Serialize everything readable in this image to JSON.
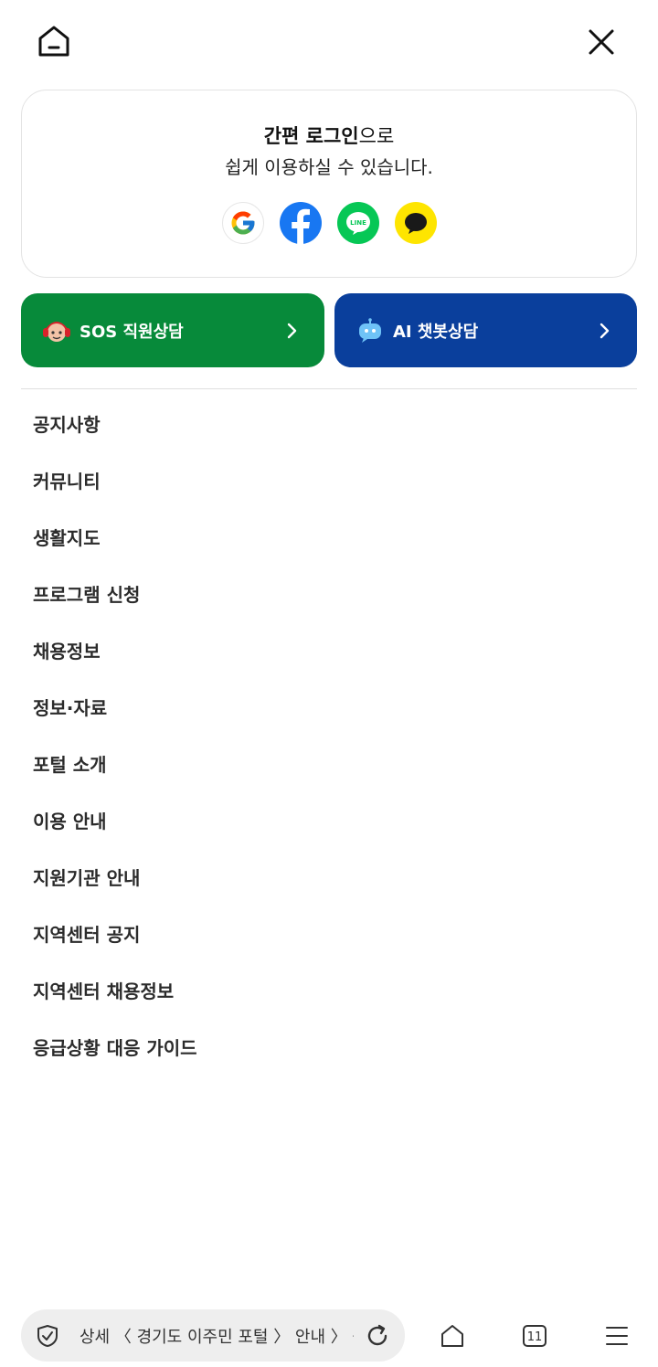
{
  "login": {
    "line1_bold": "간편 로그인",
    "line1_rest": "으로",
    "line2": "쉽게 이용하실 수 있습니다.",
    "providers": [
      "google",
      "facebook",
      "line",
      "kakao"
    ]
  },
  "consult": {
    "sos_label": "SOS 직원상담",
    "ai_label": "AI 챗봇상담"
  },
  "menu": [
    "공지사항",
    "커뮤니티",
    "생활지도",
    "프로그램 신청",
    "채용정보",
    "정보·자료",
    "포털 소개",
    "이용 안내",
    "지원기관 안내",
    "지역센터 공지",
    "지역센터 채용정보",
    "응급상황 대응 가이드"
  ],
  "browser": {
    "url_text": "상세 〈 경기도 이주민 포털 〉 안내 〉 공지",
    "tabs_count": "11"
  },
  "colors": {
    "sos": "#078a3a",
    "ai": "#0a3f9c",
    "facebook": "#1877f2",
    "line": "#06c755",
    "kakao": "#fee500"
  }
}
